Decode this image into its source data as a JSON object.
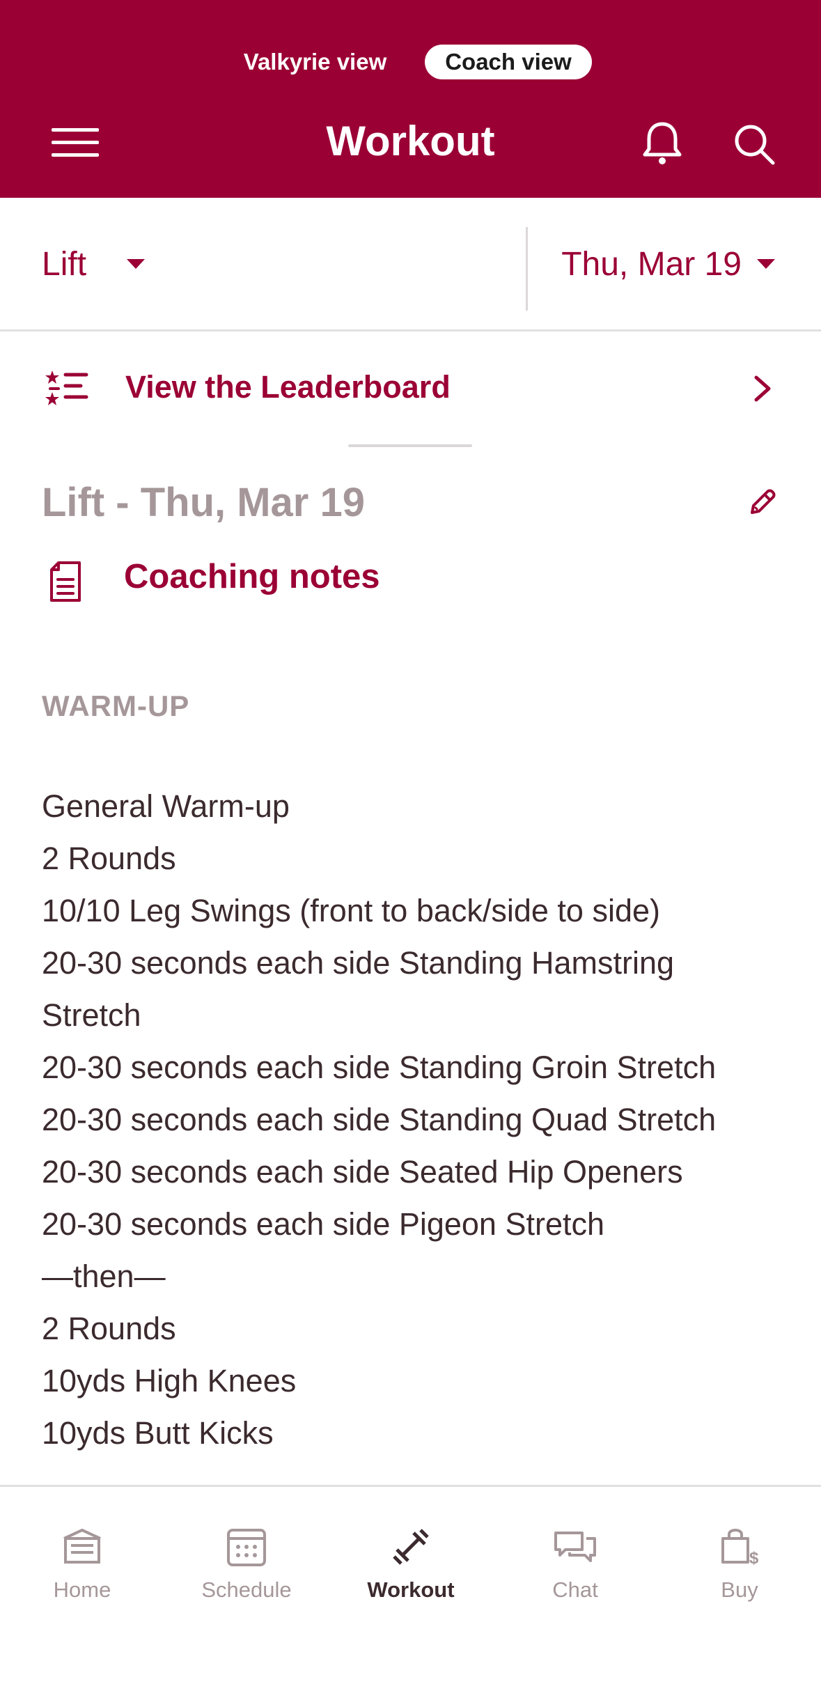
{
  "header": {
    "view_options": [
      "Valkyrie view",
      "Coach view"
    ],
    "active_view": "Coach view",
    "title": "Workout",
    "menu_icon": "hamburger-menu-icon",
    "notification_icon": "bell-icon",
    "search_icon": "search-icon"
  },
  "filters": {
    "type": "Lift",
    "date": "Thu, Mar 19"
  },
  "leaderboard": {
    "label": "View the Leaderboard",
    "icon": "leaderboard-list-icon"
  },
  "workout": {
    "title": "Lift - Thu, Mar 19",
    "coaching_notes_label": "Coaching notes",
    "section_heading": "WARM-UP",
    "lines": [
      "General Warm-up",
      "2 Rounds",
      "10/10 Leg Swings (front to back/side to side)",
      "20-30 seconds each side Standing Hamstring",
      "Stretch",
      "20-30 seconds each side Standing Groin Stretch",
      "20-30 seconds each side Standing Quad Stretch",
      "20-30 seconds each side Seated Hip Openers",
      "20-30 seconds each side Pigeon Stretch",
      "—then—",
      "2 Rounds",
      "10yds High Knees",
      "10yds Butt Kicks"
    ]
  },
  "nav": {
    "items": [
      {
        "label": "Home",
        "icon": "home-icon"
      },
      {
        "label": "Schedule",
        "icon": "calendar-icon"
      },
      {
        "label": "Workout",
        "icon": "dumbbell-icon"
      },
      {
        "label": "Chat",
        "icon": "chat-icon"
      },
      {
        "label": "Buy",
        "icon": "shopping-bag-icon"
      }
    ],
    "active": "Workout"
  },
  "colors": {
    "brand": "#9b0035",
    "muted_text": "#a59799",
    "body_text": "#3b2a2e"
  }
}
